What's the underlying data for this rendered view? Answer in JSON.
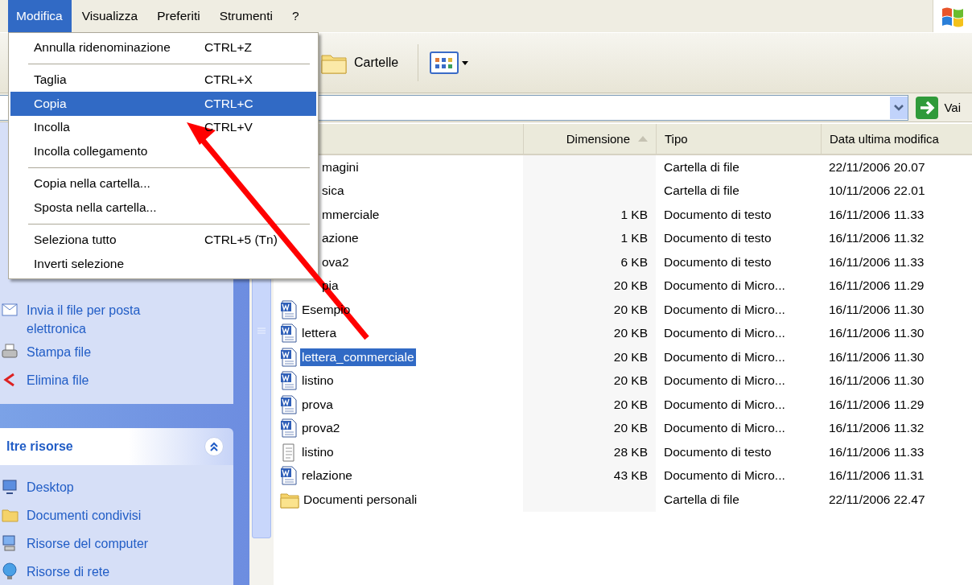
{
  "menu_bar": {
    "items": [
      {
        "label": "Modifica",
        "selected": true
      },
      {
        "label": "Visualizza",
        "selected": false
      },
      {
        "label": "Preferiti",
        "selected": false
      },
      {
        "label": "Strumenti",
        "selected": false
      },
      {
        "label": "?",
        "selected": false
      }
    ]
  },
  "edit_menu": {
    "items": [
      {
        "kind": "item",
        "label": "Annulla ridenominazione",
        "shortcut": "CTRL+Z",
        "selected": false
      },
      {
        "kind": "separator"
      },
      {
        "kind": "item",
        "label": "Taglia",
        "shortcut": "CTRL+X",
        "selected": false
      },
      {
        "kind": "item",
        "label": "Copia",
        "shortcut": "CTRL+C",
        "selected": true
      },
      {
        "kind": "item",
        "label": "Incolla",
        "shortcut": "CTRL+V",
        "selected": false
      },
      {
        "kind": "item",
        "label": "Incolla collegamento",
        "selected": false
      },
      {
        "kind": "separator"
      },
      {
        "kind": "item",
        "label": "Copia nella cartella...",
        "selected": false
      },
      {
        "kind": "item",
        "label": "Sposta nella cartella...",
        "selected": false
      },
      {
        "kind": "separator"
      },
      {
        "kind": "item",
        "label": "Seleziona tutto",
        "shortcut": "CTRL+5 (Tn)",
        "selected": false
      },
      {
        "kind": "item",
        "label": "Inverti selezione",
        "selected": false
      }
    ]
  },
  "toolbar": {
    "folders_button": "Cartelle"
  },
  "address_bar": {
    "go_button": "Vai"
  },
  "sidebar": {
    "task_items": [
      {
        "kind": "mail",
        "label": "Invia il file per posta elettronica"
      },
      {
        "kind": "print",
        "label": "Stampa file"
      },
      {
        "kind": "delete",
        "label": "Elimina file"
      }
    ],
    "other_places": {
      "title": "ltre risorse",
      "expanded": true,
      "items": [
        {
          "kind": "desktop",
          "label": "Desktop"
        },
        {
          "kind": "folder",
          "label": "Documenti condivisi"
        },
        {
          "kind": "computer",
          "label": "Risorse del computer"
        },
        {
          "kind": "network",
          "label": "Risorse di rete"
        }
      ]
    }
  },
  "file_list": {
    "columns": [
      {
        "label": "Dimensione",
        "sorted": true
      },
      {
        "label": "Tipo",
        "sorted": false
      },
      {
        "label": "Data ultima modifica",
        "sorted": false
      }
    ],
    "rows": [
      {
        "kind": "covered",
        "name": "magini",
        "size": "",
        "type": "Cartella di file",
        "modified": "22/11/2006 20.07",
        "selected": false
      },
      {
        "kind": "covered",
        "name": "sica",
        "size": "",
        "type": "Cartella di file",
        "modified": "10/11/2006 22.01",
        "selected": false
      },
      {
        "kind": "covered",
        "name": "mmerciale",
        "size": "1 KB",
        "type": "Documento di testo",
        "modified": "16/11/2006 11.33",
        "selected": false
      },
      {
        "kind": "covered",
        "name": "azione",
        "size": "1 KB",
        "type": "Documento di testo",
        "modified": "16/11/2006 11.32",
        "selected": false
      },
      {
        "kind": "covered",
        "name": "ova2",
        "size": "6 KB",
        "type": "Documento di testo",
        "modified": "16/11/2006 11.33",
        "selected": false
      },
      {
        "kind": "covered",
        "name": "pia",
        "size": "20 KB",
        "type": "Documento di Micro...",
        "modified": "16/11/2006 11.29",
        "selected": false
      },
      {
        "kind": "word",
        "name": "Esempio",
        "size": "20 KB",
        "type": "Documento di Micro...",
        "modified": "16/11/2006 11.30",
        "selected": false
      },
      {
        "kind": "word",
        "name": "lettera",
        "size": "20 KB",
        "type": "Documento di Micro...",
        "modified": "16/11/2006 11.30",
        "selected": false
      },
      {
        "kind": "word",
        "name": "lettera_commerciale",
        "size": "20 KB",
        "type": "Documento di Micro...",
        "modified": "16/11/2006 11.30",
        "selected": true
      },
      {
        "kind": "word",
        "name": "listino",
        "size": "20 KB",
        "type": "Documento di Micro...",
        "modified": "16/11/2006 11.30",
        "selected": false
      },
      {
        "kind": "word",
        "name": "prova",
        "size": "20 KB",
        "type": "Documento di Micro...",
        "modified": "16/11/2006 11.29",
        "selected": false
      },
      {
        "kind": "word",
        "name": "prova2",
        "size": "20 KB",
        "type": "Documento di Micro...",
        "modified": "16/11/2006 11.32",
        "selected": false
      },
      {
        "kind": "text",
        "name": "listino",
        "size": "28 KB",
        "type": "Documento di testo",
        "modified": "16/11/2006 11.33",
        "selected": false
      },
      {
        "kind": "word",
        "name": "relazione",
        "size": "43 KB",
        "type": "Documento di Micro...",
        "modified": "16/11/2006 11.31",
        "selected": false
      },
      {
        "kind": "folder",
        "name": "Documenti personali",
        "size": "",
        "type": "Cartella di file",
        "modified": "22/11/2006 22.47",
        "selected": false
      }
    ]
  }
}
